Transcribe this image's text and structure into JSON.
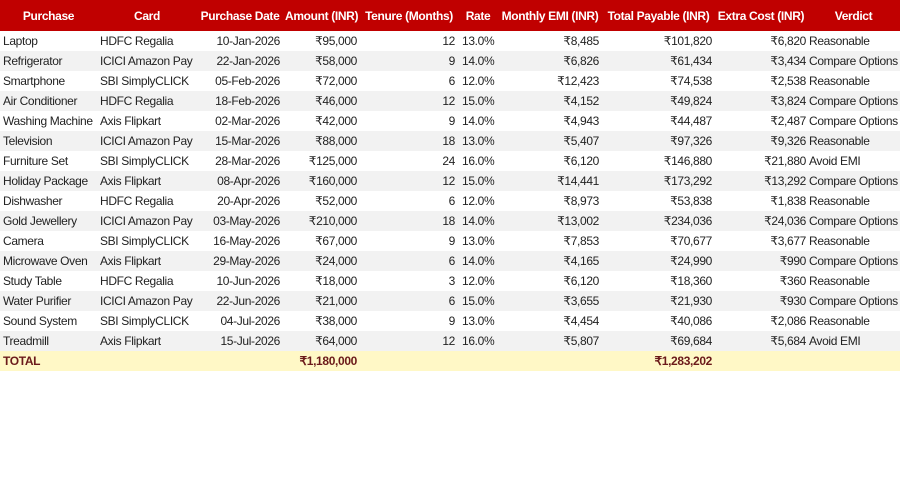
{
  "table": {
    "headers": [
      "Purchase",
      "Card",
      "Purchase Date",
      "Amount (INR)",
      "Tenure (Months)",
      "Rate",
      "Monthly EMI (INR)",
      "Total Payable (INR)",
      "Extra Cost (INR)",
      "Verdict"
    ],
    "rows": [
      [
        "Laptop",
        "HDFC Regalia",
        "10-Jan-2026",
        "₹95,000",
        "12",
        "13.0%",
        "₹8,485",
        "₹101,820",
        "₹6,820",
        "Reasonable"
      ],
      [
        "Refrigerator",
        "ICICI Amazon Pay",
        "22-Jan-2026",
        "₹58,000",
        "9",
        "14.0%",
        "₹6,826",
        "₹61,434",
        "₹3,434",
        "Compare Options"
      ],
      [
        "Smartphone",
        "SBI SimplyCLICK",
        "05-Feb-2026",
        "₹72,000",
        "6",
        "12.0%",
        "₹12,423",
        "₹74,538",
        "₹2,538",
        "Reasonable"
      ],
      [
        "Air Conditioner",
        "HDFC Regalia",
        "18-Feb-2026",
        "₹46,000",
        "12",
        "15.0%",
        "₹4,152",
        "₹49,824",
        "₹3,824",
        "Compare Options"
      ],
      [
        "Washing Machine",
        "Axis Flipkart",
        "02-Mar-2026",
        "₹42,000",
        "9",
        "14.0%",
        "₹4,943",
        "₹44,487",
        "₹2,487",
        "Compare Options"
      ],
      [
        "Television",
        "ICICI Amazon Pay",
        "15-Mar-2026",
        "₹88,000",
        "18",
        "13.0%",
        "₹5,407",
        "₹97,326",
        "₹9,326",
        "Reasonable"
      ],
      [
        "Furniture Set",
        "SBI SimplyCLICK",
        "28-Mar-2026",
        "₹125,000",
        "24",
        "16.0%",
        "₹6,120",
        "₹146,880",
        "₹21,880",
        "Avoid EMI"
      ],
      [
        "Holiday Package",
        "Axis Flipkart",
        "08-Apr-2026",
        "₹160,000",
        "12",
        "15.0%",
        "₹14,441",
        "₹173,292",
        "₹13,292",
        "Compare Options"
      ],
      [
        "Dishwasher",
        "HDFC Regalia",
        "20-Apr-2026",
        "₹52,000",
        "6",
        "12.0%",
        "₹8,973",
        "₹53,838",
        "₹1,838",
        "Reasonable"
      ],
      [
        "Gold Jewellery",
        "ICICI Amazon Pay",
        "03-May-2026",
        "₹210,000",
        "18",
        "14.0%",
        "₹13,002",
        "₹234,036",
        "₹24,036",
        "Compare Options"
      ],
      [
        "Camera",
        "SBI SimplyCLICK",
        "16-May-2026",
        "₹67,000",
        "9",
        "13.0%",
        "₹7,853",
        "₹70,677",
        "₹3,677",
        "Reasonable"
      ],
      [
        "Microwave Oven",
        "Axis Flipkart",
        "29-May-2026",
        "₹24,000",
        "6",
        "14.0%",
        "₹4,165",
        "₹24,990",
        "₹990",
        "Compare Options"
      ],
      [
        "Study Table",
        "HDFC Regalia",
        "10-Jun-2026",
        "₹18,000",
        "3",
        "12.0%",
        "₹6,120",
        "₹18,360",
        "₹360",
        "Reasonable"
      ],
      [
        "Water Purifier",
        "ICICI Amazon Pay",
        "22-Jun-2026",
        "₹21,000",
        "6",
        "15.0%",
        "₹3,655",
        "₹21,930",
        "₹930",
        "Compare Options"
      ],
      [
        "Sound System",
        "SBI SimplyCLICK",
        "04-Jul-2026",
        "₹38,000",
        "9",
        "13.0%",
        "₹4,454",
        "₹40,086",
        "₹2,086",
        "Reasonable"
      ],
      [
        "Treadmill",
        "Axis Flipkart",
        "15-Jul-2026",
        "₹64,000",
        "12",
        "16.0%",
        "₹5,807",
        "₹69,684",
        "₹5,684",
        "Avoid EMI"
      ]
    ],
    "total": {
      "label": "TOTAL",
      "amount": "₹1,180,000",
      "total_payable": "₹1,283,202"
    }
  },
  "colors": {
    "header_bg": "#c00000",
    "header_text": "#ffffff",
    "alt_row_bg": "#f2f2f2",
    "total_row_bg": "#fff8c6"
  }
}
